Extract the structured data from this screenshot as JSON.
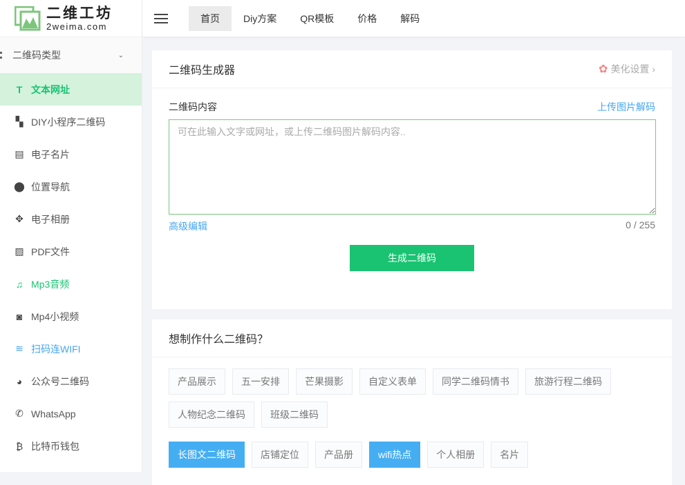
{
  "logo": {
    "cn": "二维工坊",
    "en": "2weima.com"
  },
  "sidebar": {
    "group": "二维码类型",
    "items": [
      {
        "label": "文本网址",
        "icon": "T"
      },
      {
        "label": "DIY小程序二维码",
        "icon": "▚"
      },
      {
        "label": "电子名片",
        "icon": "▤"
      },
      {
        "label": "位置导航",
        "icon": "⬤"
      },
      {
        "label": "电子相册",
        "icon": "✥"
      },
      {
        "label": "PDF文件",
        "icon": "▨"
      },
      {
        "label": "Mp3音频",
        "icon": "♫"
      },
      {
        "label": "Mp4小视频",
        "icon": "◙"
      },
      {
        "label": "扫码连WIFI",
        "icon": "≋"
      },
      {
        "label": "公众号二维码",
        "icon": "◕"
      },
      {
        "label": "WhatsApp",
        "icon": "✆"
      },
      {
        "label": "比特币钱包",
        "icon": "₿"
      }
    ]
  },
  "nav": [
    "首页",
    "Diy方案",
    "QR模板",
    "价格",
    "解码"
  ],
  "generator": {
    "title": "二维码生成器",
    "beautify": "美化设置 ›",
    "content_label": "二维码内容",
    "upload_decode": "上传图片解码",
    "placeholder": "可在此输入文字或网址，或上传二维码图片解码内容..",
    "advanced": "高级编辑",
    "count": "0 / 255",
    "generate": "生成二维码"
  },
  "ideas": {
    "title": "想制作什么二维码？",
    "tags": [
      "产品展示",
      "五一安排",
      "芒果摄影",
      "自定义表单",
      "同学二维码情书",
      "旅游行程二维码",
      "人物纪念二维码",
      "班级二维码"
    ],
    "tags2": [
      {
        "label": "长图文二维码",
        "hl": true
      },
      {
        "label": "店铺定位",
        "hl": false
      },
      {
        "label": "产品册",
        "hl": false
      },
      {
        "label": "wifi热点",
        "hl": true
      },
      {
        "label": "个人相册",
        "hl": false
      },
      {
        "label": "名片",
        "hl": false
      }
    ]
  },
  "colors": {
    "green": "#19c372",
    "blue": "#45a6f3"
  }
}
